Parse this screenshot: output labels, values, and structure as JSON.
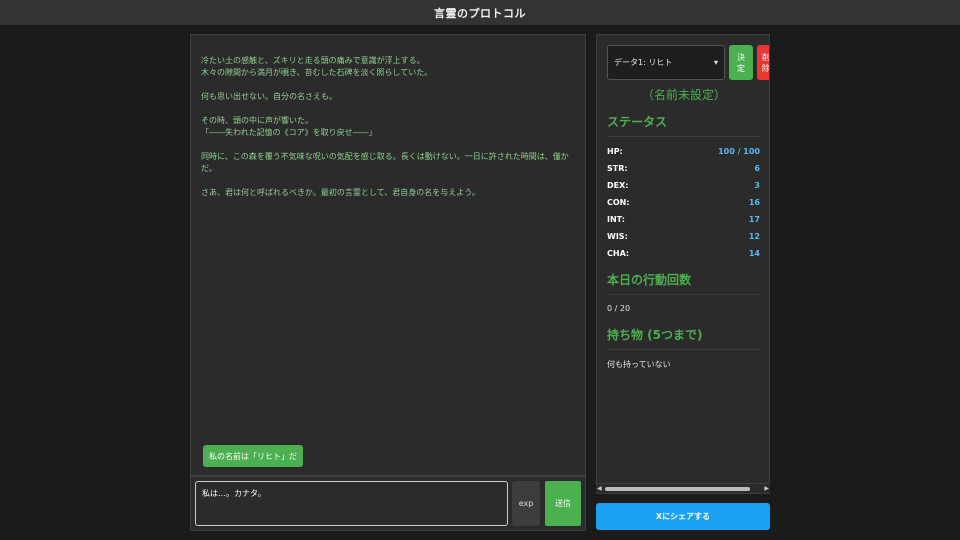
{
  "app": {
    "title": "言霊のプロトコル"
  },
  "story": {
    "paragraphs": [
      "冷たい土の感触と、ズキリと走る頭の痛みで意識が浮上する。\n木々の隙間から満月が覗き、苔むした石碑を淡く照らしていた。",
      "何も思い出せない。自分の名さえも。",
      "その時、頭の中に声が響いた。\n「――失われた記憶の《コア》を取り戻せ――」",
      "同時に、この森を覆う不気味な呪いの気配を感じ取る。長くは動けない。一日に許された時間は、僅かだ。",
      "さあ、君は何と呼ばれるべきか。最初の言霊として、君自身の名を与えよう。"
    ],
    "suggestion_label": "私の名前は「リヒト」だ"
  },
  "input": {
    "value": "私は…。カナタ。",
    "exp_label": "exp",
    "send_label": "送信"
  },
  "sidebar": {
    "save_slot_selected": "データ1: リヒト",
    "decide_label": "決\n定",
    "delete_label": "削\n除",
    "character_name": "（名前未設定）",
    "status_title": "ステータス",
    "stats": [
      {
        "label": "HP:",
        "value": "100 / 100"
      },
      {
        "label": "STR:",
        "value": "6"
      },
      {
        "label": "DEX:",
        "value": "3"
      },
      {
        "label": "CON:",
        "value": "16"
      },
      {
        "label": "INT:",
        "value": "17"
      },
      {
        "label": "WIS:",
        "value": "12"
      },
      {
        "label": "CHA:",
        "value": "14"
      }
    ],
    "actions_title": "本日の行動回数",
    "actions_value": "0 / 20",
    "inventory_title": "持ち物 (5つまで)",
    "inventory_empty": "何も持っていない"
  },
  "share": {
    "label": "Xにシェアする"
  },
  "colors": {
    "accent_green": "#4caf50",
    "stat_blue": "#5cb8f2",
    "share_blue": "#1da1f2",
    "delete_red": "#e53935"
  }
}
